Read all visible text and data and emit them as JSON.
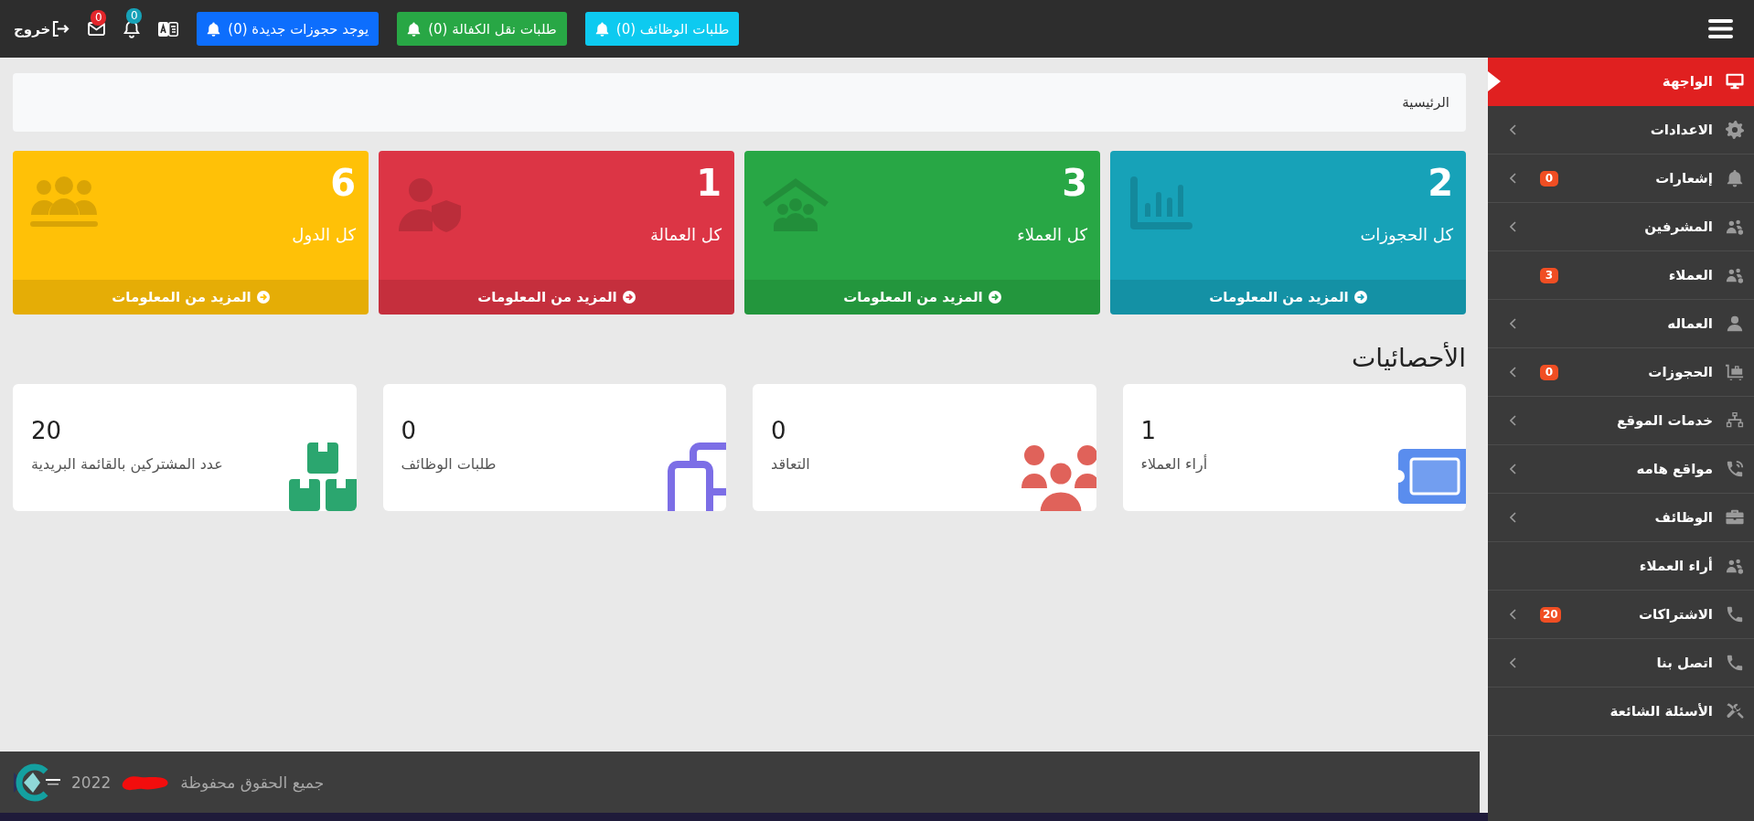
{
  "topbar": {
    "buttons": [
      {
        "label": "طلبات الوظائف (0)",
        "color": "#0dcaf0"
      },
      {
        "label": "طلبات نقل الكفالة (0)",
        "color": "#28a745"
      },
      {
        "label": "يوجد حجوزات جديدة (0)",
        "color": "#0d6efd"
      }
    ],
    "notifications": {
      "badge": "0",
      "color": "#17a2b8"
    },
    "messages": {
      "badge": "0",
      "color": "#e3262b"
    },
    "logout": "خروج"
  },
  "sidebar": {
    "items": [
      {
        "label": "الواجهة",
        "selected": true,
        "expandable": false
      },
      {
        "label": "الاعدادات",
        "selected": false,
        "expandable": true
      },
      {
        "label": "إشعارات",
        "badge": "0",
        "selected": false,
        "expandable": true
      },
      {
        "label": "المشرفين",
        "selected": false,
        "expandable": true
      },
      {
        "label": "العملاء",
        "badge": "3",
        "selected": false,
        "expandable": false
      },
      {
        "label": "العماله",
        "selected": false,
        "expandable": true
      },
      {
        "label": "الحجوزات",
        "badge": "0",
        "selected": false,
        "expandable": true
      },
      {
        "label": "خدمات الموقع",
        "selected": false,
        "expandable": true
      },
      {
        "label": "مواقع هامه",
        "selected": false,
        "expandable": true
      },
      {
        "label": "الوظائف",
        "selected": false,
        "expandable": true
      },
      {
        "label": "أراء العملاء",
        "selected": false,
        "expandable": false
      },
      {
        "label": "الاشتراكات",
        "badge": "20",
        "selected": false,
        "expandable": true
      },
      {
        "label": "اتصل بنا",
        "selected": false,
        "expandable": true
      },
      {
        "label": "الأسئلة الشائعة",
        "selected": false,
        "expandable": false
      }
    ]
  },
  "breadcrumb": "الرئيسية",
  "cards": [
    {
      "value": "2",
      "label": "كل الحجوزات",
      "link": "المزيد من المعلومات",
      "color": "#17a2b8"
    },
    {
      "value": "3",
      "label": "كل العملاء",
      "link": "المزيد من المعلومات",
      "color": "#28a745"
    },
    {
      "value": "1",
      "label": "كل العمالة",
      "link": "المزيد من المعلومات",
      "color": "#dc3545"
    },
    {
      "value": "6",
      "label": "كل الدول",
      "link": "المزيد من المعلومات",
      "color": "#ffc107"
    }
  ],
  "statistics": {
    "title": "الأحصائيات",
    "items": [
      {
        "value": "1",
        "label": "أراء العملاء",
        "color": "#5a8dee"
      },
      {
        "value": "0",
        "label": "التعاقد",
        "color": "#e0625a"
      },
      {
        "value": "0",
        "label": "طلبات الوظائف",
        "color": "#7c6ee6"
      },
      {
        "value": "20",
        "label": "عدد المشتركين بالقائمة البريدية",
        "color": "#2ba66f"
      }
    ]
  },
  "footer": {
    "copyright": "جميع الحقوق محفوظة",
    "year": "2022"
  }
}
